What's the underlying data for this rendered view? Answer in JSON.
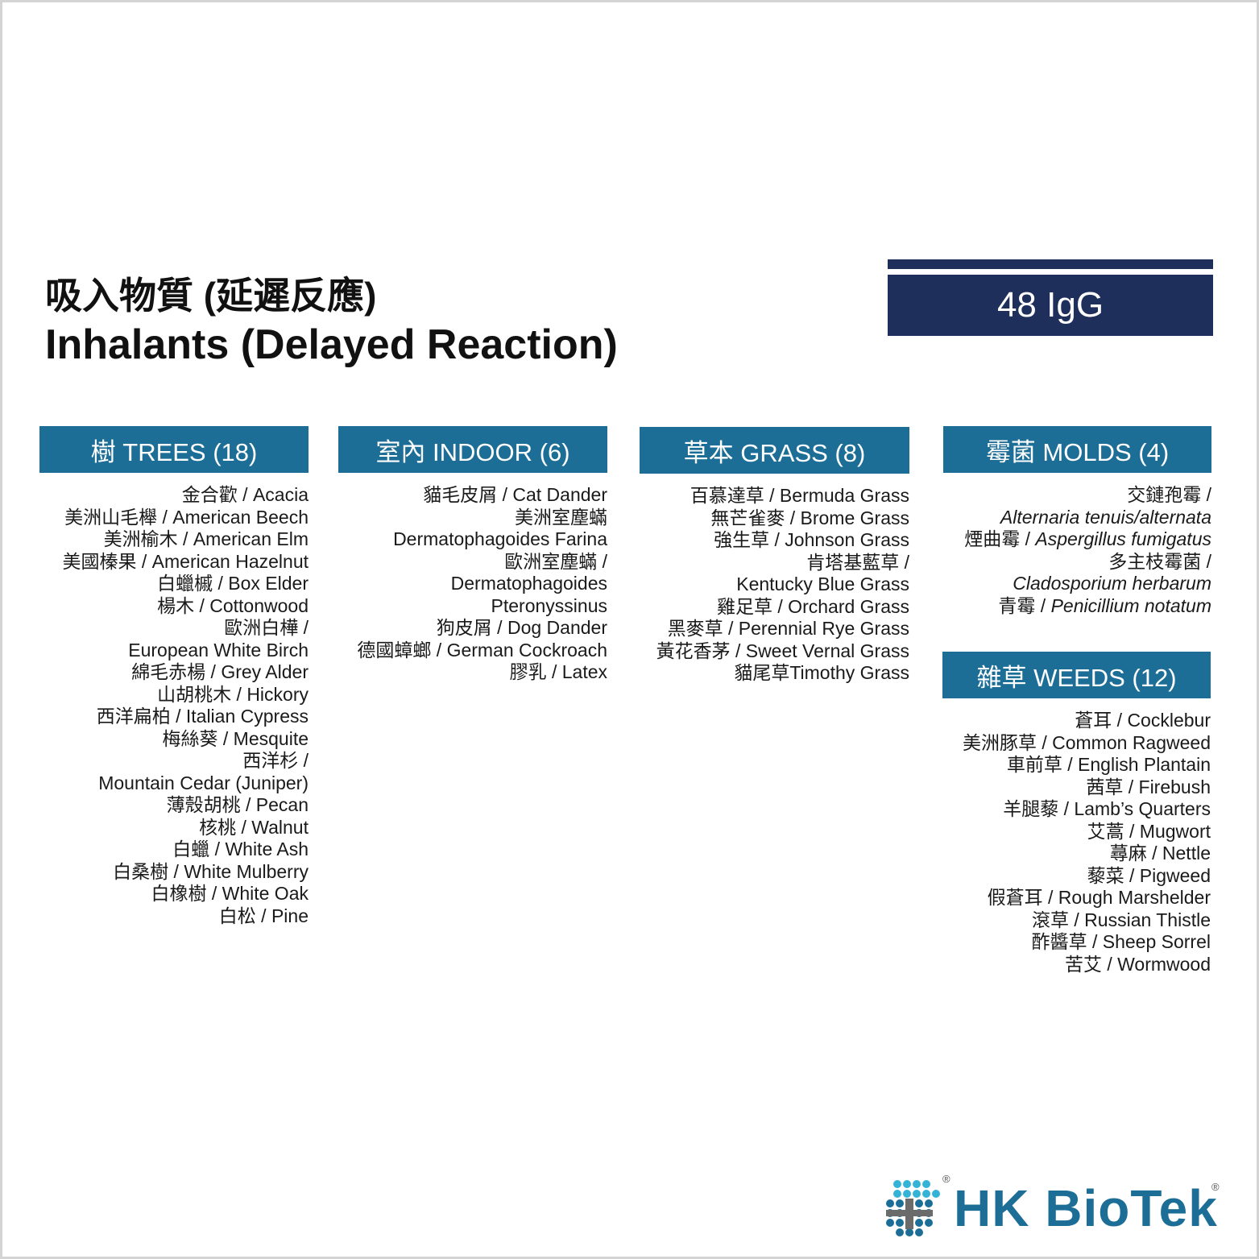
{
  "title": {
    "zh": "吸入物質 (延遲反應)",
    "en": "Inhalants (Delayed Reaction)"
  },
  "badge": "48 IgG",
  "sections": [
    {
      "header": "樹 TREES (18)",
      "items": [
        {
          "zh": "金合歡",
          "en": "Acacia"
        },
        {
          "zh": "美洲山毛櫸",
          "en": "American Beech"
        },
        {
          "zh": "美洲榆木",
          "en": "American Elm"
        },
        {
          "zh": "美國榛果",
          "en": "American Hazelnut"
        },
        {
          "zh": "白蠟槭",
          "en": "Box Elder"
        },
        {
          "zh": "楊木",
          "en": "Cottonwood"
        },
        {
          "zh": "歐洲白樺",
          "en": "European White Birch"
        },
        {
          "zh": "綿毛赤楊",
          "en": "Grey Alder"
        },
        {
          "zh": "山胡桃木",
          "en": "Hickory"
        },
        {
          "zh": "西洋扁柏",
          "en": "Italian Cypress"
        },
        {
          "zh": "梅絲葵",
          "en": "Mesquite"
        },
        {
          "zh": "西洋杉",
          "en": "Mountain Cedar (Juniper)"
        },
        {
          "zh": "薄殼胡桃",
          "en": "Pecan"
        },
        {
          "zh": "核桃",
          "en": "Walnut"
        },
        {
          "zh": "白蠟",
          "en": "White Ash"
        },
        {
          "zh": "白桑樹",
          "en": "White Mulberry"
        },
        {
          "zh": "白橡樹",
          "en": "White Oak"
        },
        {
          "zh": "白松",
          "en": "Pine"
        }
      ],
      "lines": [
        "金合歡 / Acacia",
        "美洲山毛櫸 / American Beech",
        "美洲榆木 / American Elm",
        "美國榛果 / American Hazelnut",
        "白蠟槭 / Box Elder",
        "楊木 / Cottonwood",
        "歐洲白樺 /",
        "European White Birch",
        "綿毛赤楊 / Grey Alder",
        "山胡桃木 / Hickory",
        "西洋扁柏 / Italian Cypress",
        "梅絲葵 / Mesquite",
        "西洋杉 /",
        "Mountain Cedar (Juniper)",
        "薄殼胡桃 / Pecan",
        "核桃 / Walnut",
        "白蠟 / White Ash",
        "白桑樹 / White Mulberry",
        "白橡樹 / White Oak",
        "白松 / Pine"
      ]
    },
    {
      "header": "室內 INDOOR (6)",
      "lines": [
        "貓毛皮屑 / Cat Dander",
        "美洲室塵蟎",
        "Dermatophagoides Farina",
        "歐洲室塵蟎 /",
        "Dermatophagoides",
        "Pteronyssinus",
        "狗皮屑 / Dog Dander",
        "德國蟑螂 / German Cockroach",
        "膠乳 / Latex"
      ]
    },
    {
      "header": "草本 GRASS (8)",
      "lines": [
        "百慕達草 / Bermuda Grass",
        "無芒雀麥 / Brome Grass",
        "強生草 / Johnson Grass",
        "肯塔基藍草 /",
        "Kentucky Blue Grass",
        "雞足草 / Orchard Grass",
        "黑麥草 / Perennial Rye Grass",
        "黃花香茅 / Sweet Vernal Grass",
        "貓尾草Timothy Grass"
      ]
    },
    {
      "header": "霉菌 MOLDS (4)",
      "lines": [
        {
          "zh": "交鏈孢霉 /",
          "en": ""
        },
        {
          "zh": "",
          "en": "Alternaria tenuis/alternata"
        },
        {
          "zh": "煙曲霉 / ",
          "en": "Aspergillus fumigatus"
        },
        {
          "zh": "多主枝霉菌 /",
          "en": ""
        },
        {
          "zh": "",
          "en": "Cladosporium herbarum"
        },
        {
          "zh": "青霉 / ",
          "en": "Penicillium notatum"
        }
      ]
    },
    {
      "header": "雜草 WEEDS (12)",
      "lines": [
        "蒼耳 / Cocklebur",
        "美洲豚草 / Common Ragweed",
        "車前草 / English Plantain",
        "茜草 / Firebush",
        "羊腿藜 / Lamb’s Quarters",
        "艾蒿 / Mugwort",
        "蕁麻 / Nettle",
        "藜菜 / Pigweed",
        "假蒼耳 / Rough Marshelder",
        "滾草 / Russian Thistle",
        "酢醬草 / Sheep Sorrel",
        "苦艾 / Wormwood"
      ]
    }
  ],
  "logo": {
    "text": "HK BioTek",
    "registered": "®"
  },
  "colors": {
    "header_bg": "#1c6e96",
    "badge_bg": "#1f2f5b",
    "logo_blue": "#1c6e96",
    "logo_cyan": "#35b3d6"
  }
}
